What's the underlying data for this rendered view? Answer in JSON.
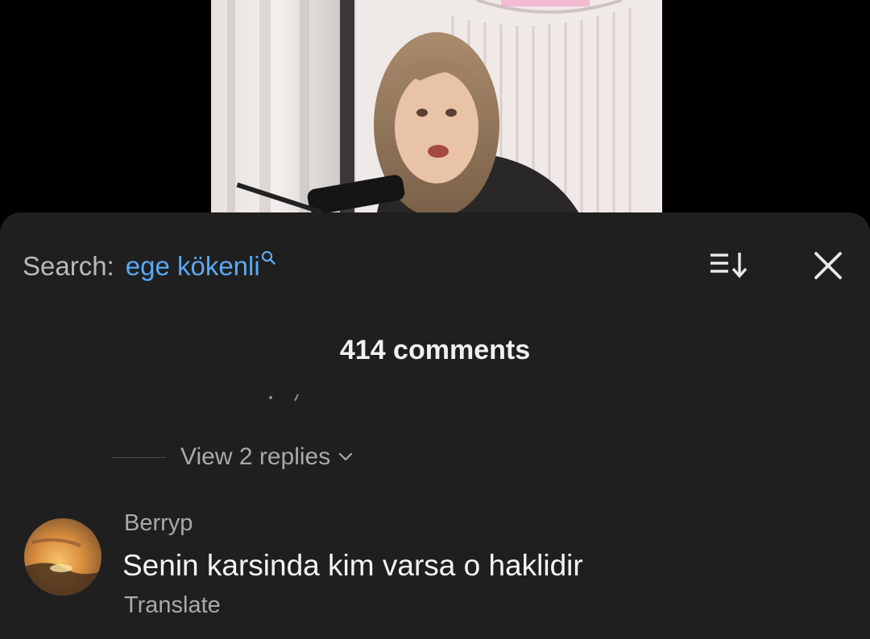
{
  "search": {
    "label": "Search:",
    "query": "ege kökenli"
  },
  "comments_header": {
    "count_text": "414 comments"
  },
  "thread": {
    "view_replies_label": "View 2 replies"
  },
  "comment": {
    "author": "Berryp",
    "text": "Senin karsinda kim varsa o haklidir",
    "translate_label": "Translate"
  },
  "icons": {
    "search": "search-icon",
    "sort": "sort-icon",
    "close": "close-icon",
    "chevron": "chevron-down-icon"
  },
  "colors": {
    "sheet_background": "#1f1f1f",
    "query_blue": "#5aa8f2",
    "secondary_text": "#a9a9a9",
    "primary_text": "#f1f1f1"
  }
}
